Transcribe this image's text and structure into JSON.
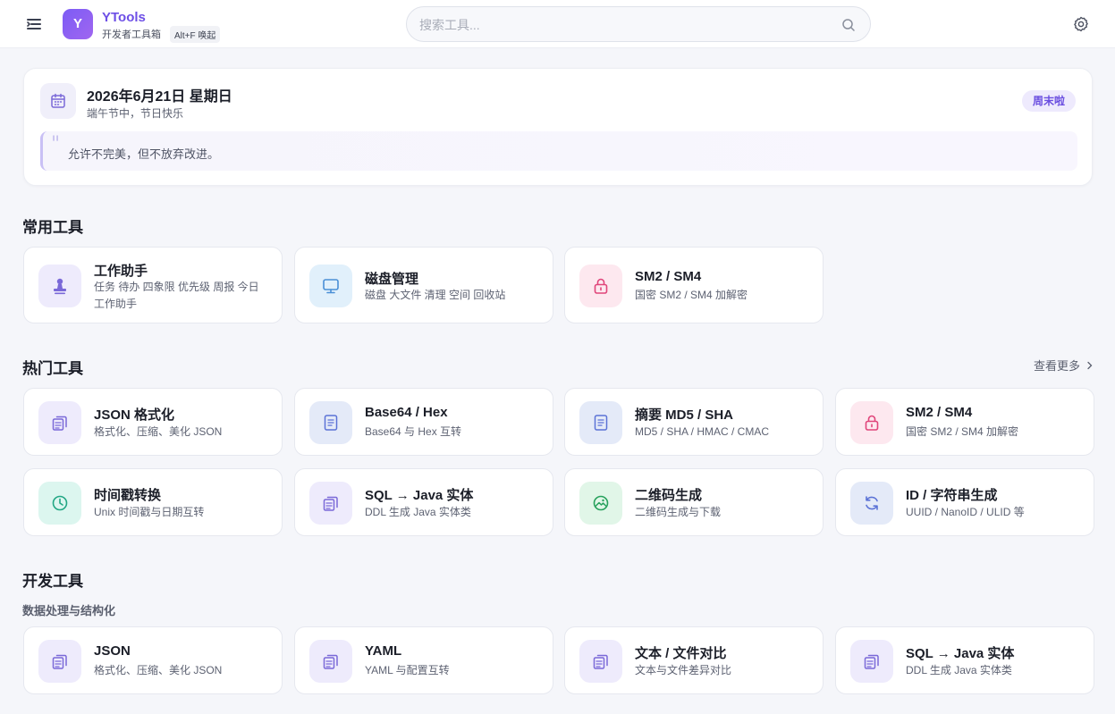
{
  "header": {
    "logo_letter": "Y",
    "app_title": "YTools",
    "app_subtitle": "开发者工具箱",
    "hotkey": "Alt+F 唤起",
    "search_placeholder": "搜索工具..."
  },
  "date_card": {
    "date": "2026年6月21日 星期日",
    "note": "端午节中，节日快乐",
    "badge": "周末啦",
    "quote_mark": "\"",
    "quote": "允许不完美，但不放弃改进。"
  },
  "sections": {
    "common": {
      "title": "常用工具",
      "tools": [
        {
          "name": "工作助手",
          "desc": "任务 待办 四象限 优先级 周报 今日工作助手",
          "icon": "stamp-icon"
        },
        {
          "name": "磁盘管理",
          "desc": "磁盘 大文件 清理 空间 回收站",
          "icon": "monitor-icon"
        },
        {
          "name": "SM2 / SM4",
          "desc": "国密 SM2 / SM4 加解密",
          "icon": "lock-icon"
        }
      ]
    },
    "hot": {
      "title": "热门工具",
      "more": "查看更多",
      "tools": [
        {
          "name": "JSON 格式化",
          "desc": "格式化、压缩、美化 JSON",
          "icon": "copy-icon"
        },
        {
          "name": "Base64 / Hex",
          "desc": "Base64 与 Hex 互转",
          "icon": "document-icon"
        },
        {
          "name": "摘要 MD5 / SHA",
          "desc": "MD5 / SHA / HMAC / CMAC",
          "icon": "document-icon"
        },
        {
          "name": "SM2 / SM4",
          "desc": "国密 SM2 / SM4 加解密",
          "icon": "lock-icon"
        },
        {
          "name": "时间戳转换",
          "desc": "Unix 时间戳与日期互转",
          "icon": "clock-icon"
        },
        {
          "name": "SQL → Java 实体",
          "desc": "DDL 生成 Java 实体类",
          "icon": "copy-icon"
        },
        {
          "name": "二维码生成",
          "desc": "二维码生成与下载",
          "icon": "image-icon"
        },
        {
          "name": "ID / 字符串生成",
          "desc": "UUID / NanoID / ULID 等",
          "icon": "refresh-icon"
        }
      ]
    },
    "dev": {
      "title": "开发工具",
      "subtitle": "数据处理与结构化",
      "tools": [
        {
          "name": "JSON",
          "desc": "格式化、压缩、美化 JSON",
          "icon": "copy-icon"
        },
        {
          "name": "YAML",
          "desc": "YAML 与配置互转",
          "icon": "copy-icon"
        },
        {
          "name": "文本 / 文件对比",
          "desc": "文本与文件差异对比",
          "icon": "copy-icon"
        },
        {
          "name": "SQL → Java 实体",
          "desc": "DDL 生成 Java 实体类",
          "icon": "copy-icon"
        }
      ]
    }
  },
  "colors": {
    "accent": "#6d4fe6",
    "purple_icon": "#7a69d8",
    "blue_icon": "#4a8fd6",
    "pink_icon": "#e0457a",
    "teal_icon": "#22a784",
    "green_icon": "#27a15c",
    "indigo_icon": "#5b72d6"
  }
}
